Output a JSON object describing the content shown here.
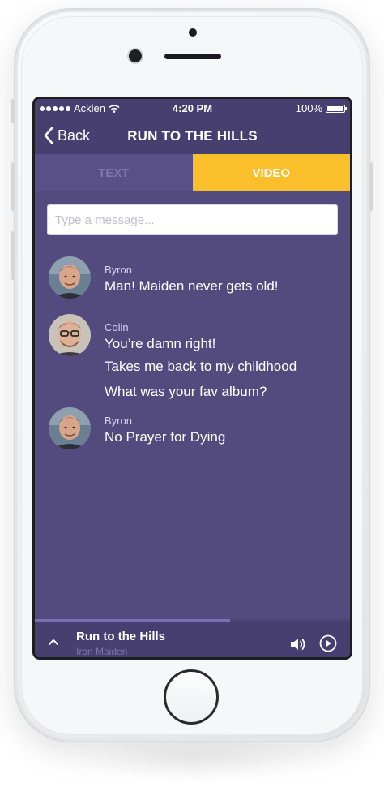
{
  "status": {
    "carrier": "Acklen",
    "time": "4:20 PM",
    "battery": "100%"
  },
  "nav": {
    "back_label": "Back",
    "title": "RUN TO THE HILLS"
  },
  "tabs": [
    {
      "label": "TEXT",
      "active": false
    },
    {
      "label": "VIDEO",
      "active": true
    }
  ],
  "composer": {
    "placeholder": "Type a message...",
    "value": ""
  },
  "messages": [
    {
      "sender": "Byron",
      "avatar": "byron-avatar",
      "lines": [
        "Man! Maiden never gets old!"
      ]
    },
    {
      "sender": "Colin",
      "avatar": "colin-avatar",
      "lines": [
        "You’re damn right!",
        "Takes me back to my childhood",
        "What was your fav album?"
      ]
    },
    {
      "sender": "Byron",
      "avatar": "byron-avatar",
      "lines": [
        "No Prayer for Dying"
      ]
    }
  ],
  "player": {
    "song": "Run to the Hills",
    "artist": "Iron Maiden",
    "progress": 0.62
  },
  "colors": {
    "background": "#534a7e",
    "bar": "#473f70",
    "accent": "#fbbf2c",
    "inactive_tab": "#5a5088"
  },
  "icons": [
    "back-chevron-icon",
    "wifi-icon",
    "battery-icon",
    "chevron-up-icon",
    "volume-icon",
    "play-icon"
  ]
}
